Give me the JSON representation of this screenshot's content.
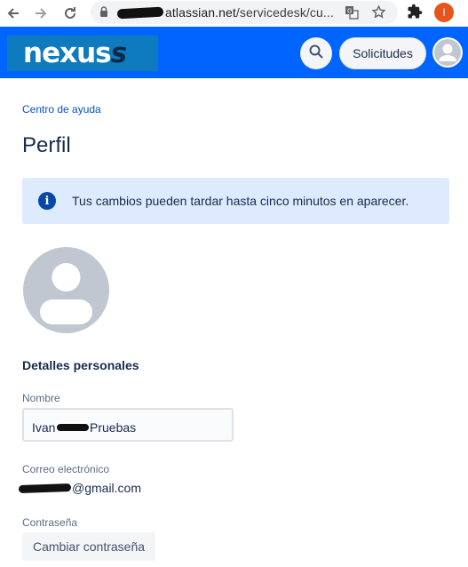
{
  "browser": {
    "url_host": "atlassian.net",
    "url_path": "/servicedesk/cu...",
    "profile_initial": "I"
  },
  "header": {
    "logo_main": "nexus",
    "logo_tail": "s",
    "requests_label": "Solicitudes",
    "brand_color": "#0065ff"
  },
  "breadcrumb": "Centro de ayuda",
  "page_title": "Perfil",
  "banner": {
    "message": "Tus cambios pueden tardar hasta cinco minutos en aparecer."
  },
  "personal": {
    "heading": "Detalles personales",
    "name_label": "Nombre",
    "name_first": "Ivan",
    "name_last": "Pruebas",
    "email_label": "Correo electrónico",
    "email_domain": "@gmail.com",
    "password_label": "Contraseña",
    "change_password": "Cambiar contraseña"
  }
}
